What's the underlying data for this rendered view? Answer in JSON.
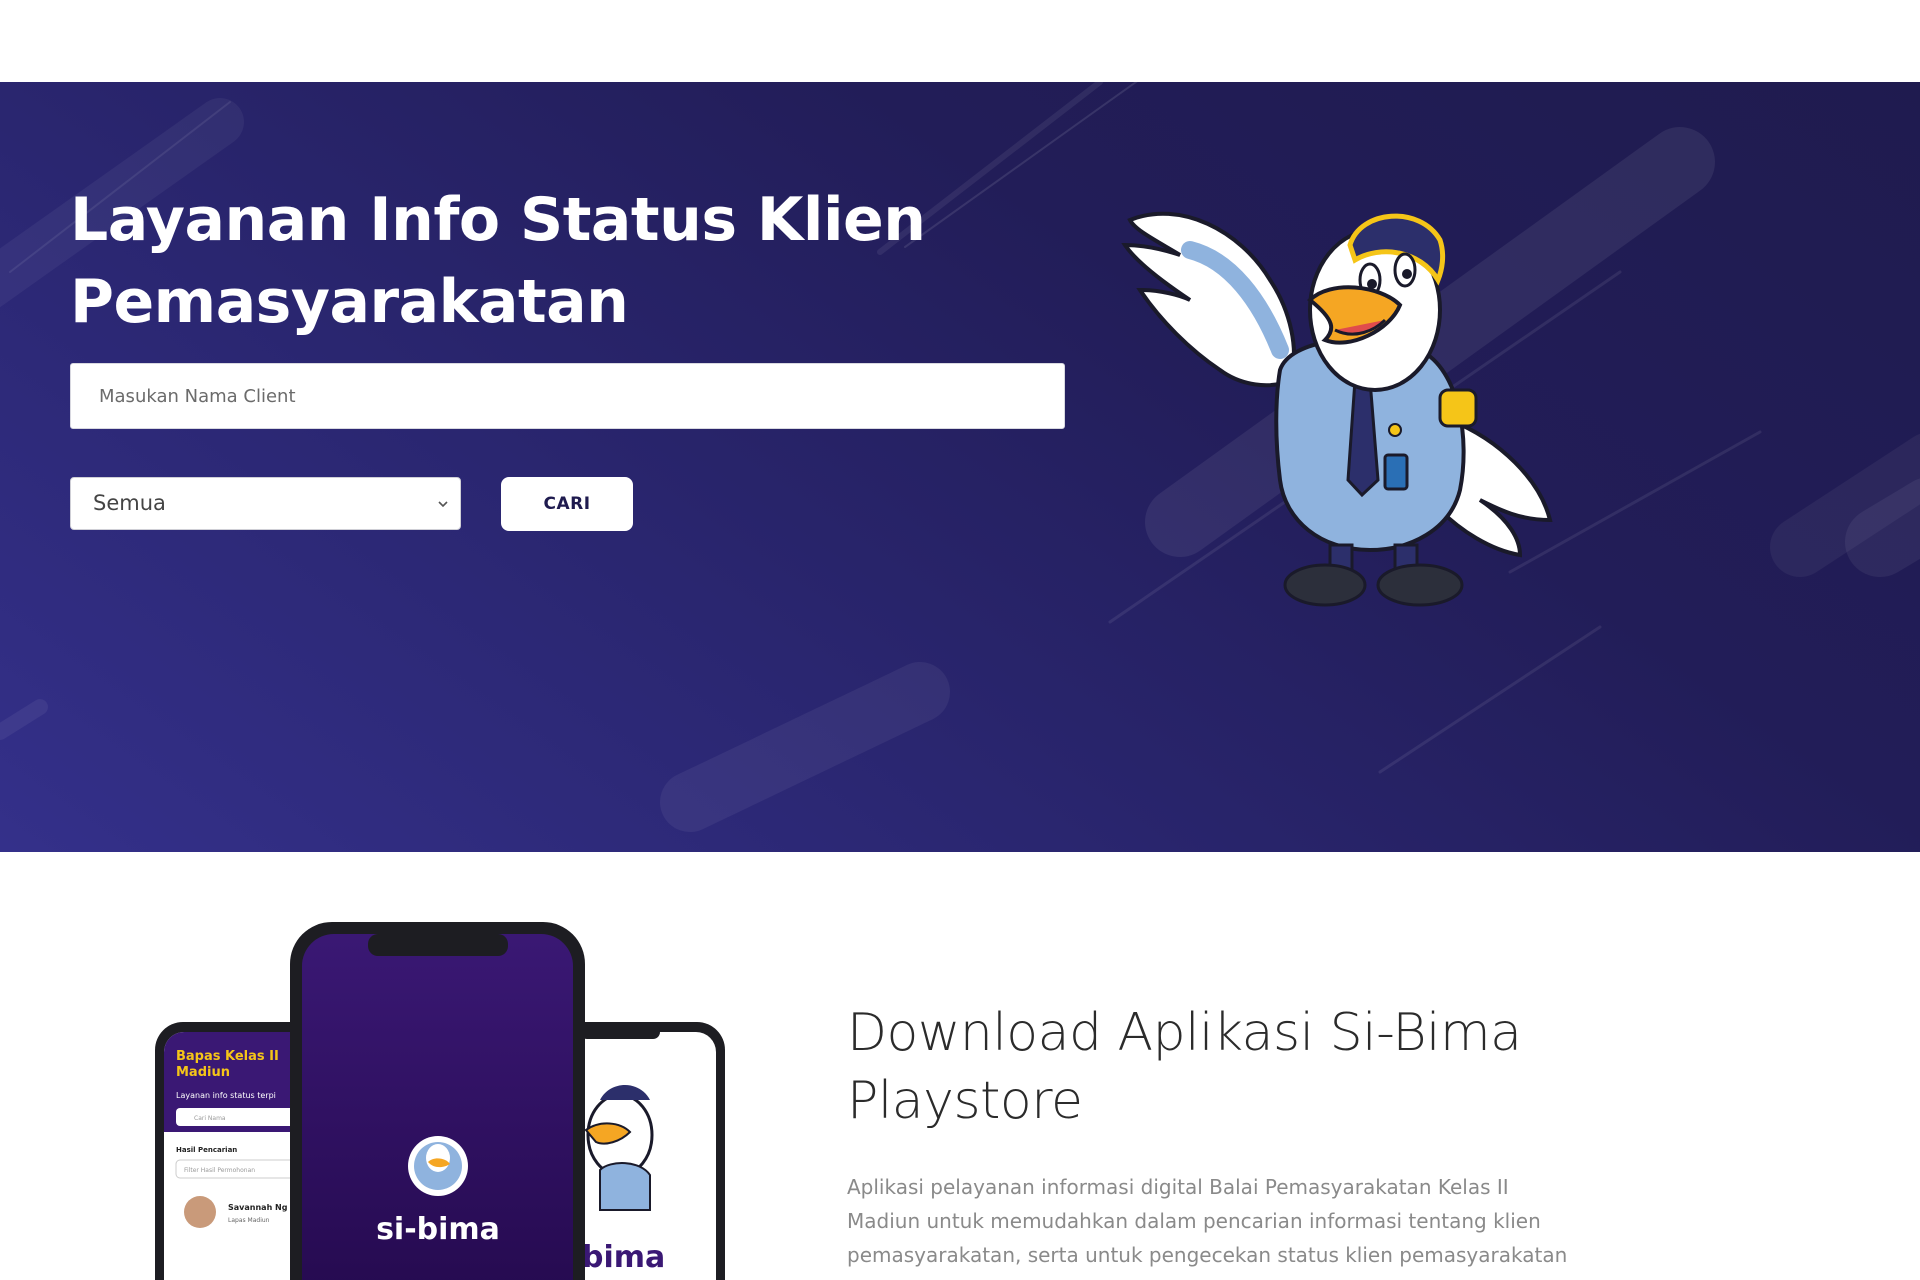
{
  "hero": {
    "title": "Layanan Info Status Klien Pemasyarakatan",
    "search_placeholder": "Masukan Nama Client",
    "filter_selected": "Semua",
    "search_button": "CARI"
  },
  "download": {
    "title": "Download Aplikasi Si-Bima Playstore",
    "description": "Aplikasi pelayanan informasi digital Balai Pemasyarakatan Kelas II Madiun untuk memudahkan dalam pencarian informasi tentang klien pemasyarakatan, serta untuk pengecekan status klien pemasyarakatan",
    "phone_left_title": "Bapas Kelas II Madiun",
    "phone_left_subtitle": "Layanan info status terpi",
    "phone_left_search": "Cari Nama",
    "phone_left_results": "Hasil Pencarian",
    "phone_left_filter": "Filter Hasil Permohonan",
    "phone_left_person": "Savannah Ng",
    "phone_left_person_sub": "Lapas Madiun",
    "phone_center_logo": "si-bima",
    "phone_right_logo": "bima"
  },
  "colors": {
    "hero_dark": "#1f1b4f",
    "hero_light": "#34308a",
    "phone_purple": "#3a1874",
    "accent_yellow": "#f5c518"
  }
}
